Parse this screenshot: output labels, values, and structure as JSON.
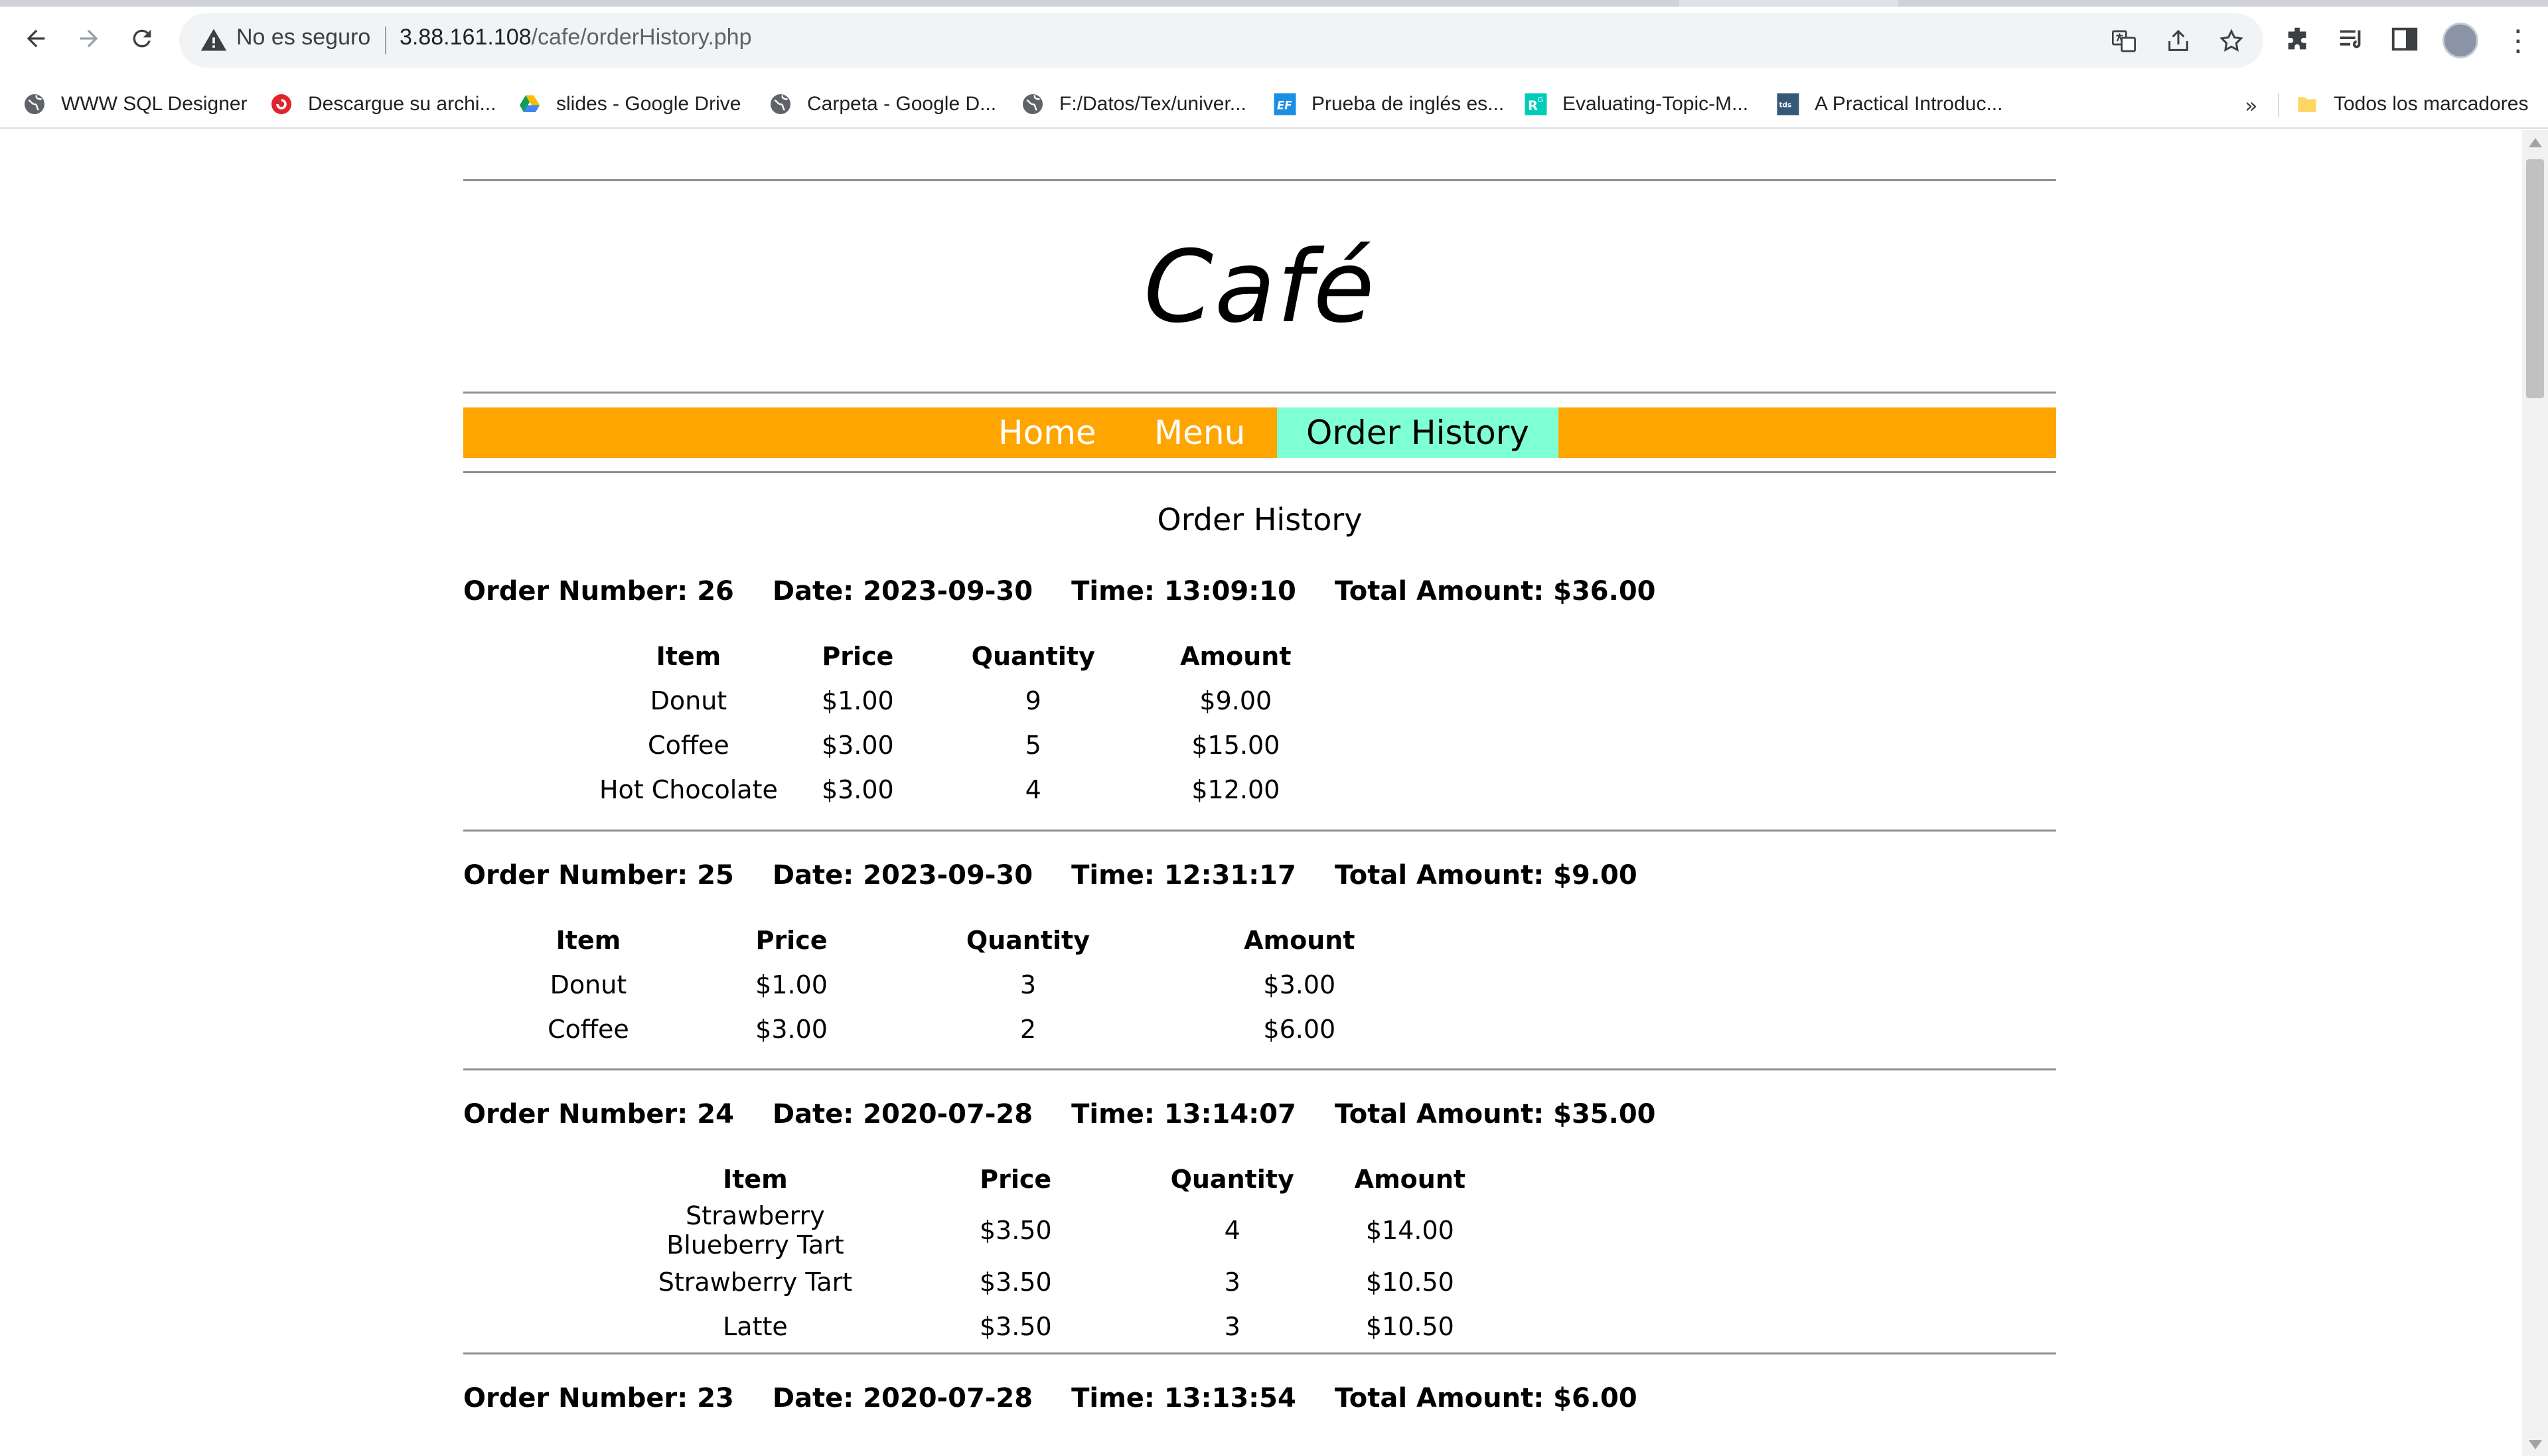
{
  "browser": {
    "security_label": "No es seguro",
    "url_host": "3.88.161.108",
    "url_path": "/cafe/orderHistory.php",
    "bookmarks": [
      {
        "label": "WWW SQL Designer",
        "icon": "globe-icon"
      },
      {
        "label": "Descargue su archi...",
        "icon": "red-circle-icon"
      },
      {
        "label": "slides - Google Drive",
        "icon": "google-drive-icon"
      },
      {
        "label": "Carpeta - Google D...",
        "icon": "globe-icon"
      },
      {
        "label": "F:/Datos/Tex/univer...",
        "icon": "globe-icon"
      },
      {
        "label": "Prueba de inglés es...",
        "icon": "ef-icon"
      },
      {
        "label": "Evaluating-Topic-M...",
        "icon": "researchgate-icon"
      },
      {
        "label": "A Practical Introduc...",
        "icon": "tds-icon"
      }
    ],
    "bookmarks_overflow": "»",
    "all_bookmarks": "Todos los marcadores"
  },
  "site": {
    "title": "Café",
    "nav": [
      {
        "label": "Home",
        "active": false
      },
      {
        "label": "Menu",
        "active": false
      },
      {
        "label": "Order History",
        "active": true
      }
    ],
    "section_heading": "Order History"
  },
  "table_headers": [
    "Item",
    "Price",
    "Quantity",
    "Amount"
  ],
  "orders": [
    {
      "number": "Order Number: 26",
      "date": "Date: 2023-09-30",
      "time": "Time: 13:09:10",
      "total": "Total Amount: $36.00",
      "rows": [
        [
          "Donut",
          "$1.00",
          "9",
          "$9.00"
        ],
        [
          "Coffee",
          "$3.00",
          "5",
          "$15.00"
        ],
        [
          "Hot Chocolate",
          "$3.00",
          "4",
          "$12.00"
        ]
      ]
    },
    {
      "number": "Order Number: 25",
      "date": "Date: 2023-09-30",
      "time": "Time: 12:31:17",
      "total": "Total Amount: $9.00",
      "rows": [
        [
          "Donut",
          "$1.00",
          "3",
          "$3.00"
        ],
        [
          "Coffee",
          "$3.00",
          "2",
          "$6.00"
        ]
      ]
    },
    {
      "number": "Order Number: 24",
      "date": "Date: 2020-07-28",
      "time": "Time: 13:14:07",
      "total": "Total Amount: $35.00",
      "rows": [
        [
          "Strawberry Blueberry Tart",
          "$3.50",
          "4",
          "$14.00"
        ],
        [
          "Strawberry Tart",
          "$3.50",
          "3",
          "$10.50"
        ],
        [
          "Latte",
          "$3.50",
          "3",
          "$10.50"
        ]
      ]
    },
    {
      "number": "Order Number: 23",
      "date": "Date: 2020-07-28",
      "time": "Time: 13:13:54",
      "total": "Total Amount: $6.00",
      "rows": []
    }
  ],
  "colors": {
    "nav_background": "#ffa500",
    "nav_active_background": "#7fffd4",
    "nav_text": "#ffffff",
    "rule": "#8e8e8e"
  }
}
